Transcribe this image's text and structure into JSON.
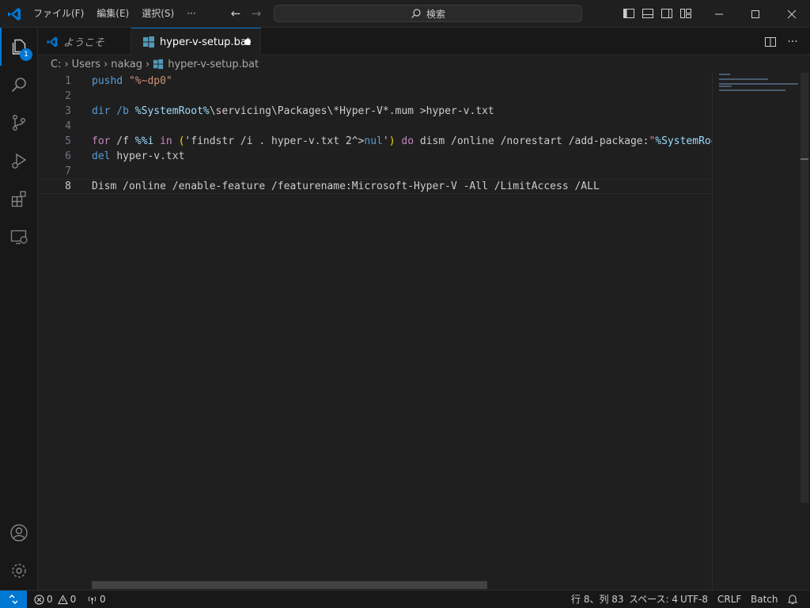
{
  "menu": {
    "file": "ファイル(F)",
    "edit": "編集(E)",
    "selection": "選択(S)",
    "more": "···"
  },
  "search": {
    "label": "検索"
  },
  "tabs": {
    "welcome": "ようこそ",
    "file": "hyper-v-setup.bat"
  },
  "explorer_badge": "1",
  "breadcrumb": [
    "C:",
    "Users",
    "nakag",
    "hyper-v-setup.bat"
  ],
  "editor": {
    "current_line": 8,
    "lines": [
      {
        "n": "1",
        "segments": [
          {
            "t": "pushd ",
            "c": "kw"
          },
          {
            "t": "\"%~dp0\"",
            "c": "str"
          }
        ]
      },
      {
        "n": "2",
        "segments": []
      },
      {
        "n": "3",
        "segments": [
          {
            "t": "dir /b ",
            "c": "kw"
          },
          {
            "t": "%SystemRoot%",
            "c": "var"
          },
          {
            "t": "\\servicing\\Packages\\*Hyper-V*.mum >hyper-v.txt",
            "c": "plain"
          }
        ]
      },
      {
        "n": "4",
        "segments": []
      },
      {
        "n": "5",
        "segments": [
          {
            "t": "for",
            "c": "ctl"
          },
          {
            "t": " /f ",
            "c": "plain"
          },
          {
            "t": "%%i",
            "c": "var"
          },
          {
            "t": " in ",
            "c": "ctl"
          },
          {
            "t": "(",
            "c": "paren"
          },
          {
            "t": "'findstr /i . hyper-v.txt 2^>",
            "c": "plain"
          },
          {
            "t": "nul",
            "c": "kw"
          },
          {
            "t": "'",
            "c": "plain"
          },
          {
            "t": ")",
            "c": "paren"
          },
          {
            "t": " do ",
            "c": "ctl"
          },
          {
            "t": "dism /online /norestart /add-package:",
            "c": "plain"
          },
          {
            "t": "\"",
            "c": "str"
          },
          {
            "t": "%SystemRoot",
            "c": "var"
          }
        ]
      },
      {
        "n": "6",
        "segments": [
          {
            "t": "del ",
            "c": "kw"
          },
          {
            "t": "hyper-v.txt",
            "c": "plain"
          }
        ]
      },
      {
        "n": "7",
        "segments": []
      },
      {
        "n": "8",
        "segments": [
          {
            "t": "Dism /online /enable-feature /featurename:Microsoft-Hyper-V -All /LimitAccess /ALL",
            "c": "plain"
          }
        ]
      }
    ]
  },
  "status": {
    "errors": "0",
    "warnings": "0",
    "ports": "0",
    "position": "行 8、列 83",
    "spaces": "スペース: 4",
    "encoding": "UTF-8",
    "eol": "CRLF",
    "language": "Batch"
  },
  "colors": {
    "accent": "#0078d4",
    "keyword": "#569cd6",
    "string": "#ce9178",
    "variable": "#9cdcfe",
    "control": "#c586c0"
  },
  "icons": {
    "explorer": "files-icon",
    "search": "search-icon",
    "scm": "source-control-icon",
    "debug": "run-debug-icon",
    "extensions": "extensions-icon",
    "remote": "remote-explorer-icon",
    "account": "account-icon",
    "settings": "gear-icon"
  }
}
